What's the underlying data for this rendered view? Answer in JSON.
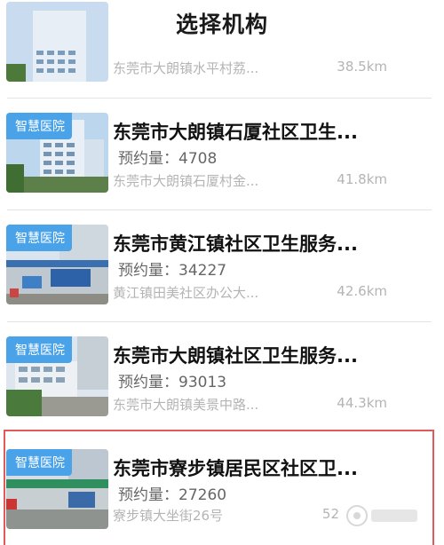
{
  "header": {
    "title": "选择机构"
  },
  "items": [
    {
      "badge": "",
      "name": "",
      "count_label": "",
      "address": "东莞市大朗镇水平村荔...",
      "distance": "38.5km"
    },
    {
      "badge": "智慧医院",
      "name": "东莞市大朗镇石厦社区卫生...",
      "count_label": "预约量：4708",
      "address": "东莞市大朗镇石厦村金...",
      "distance": "41.8km"
    },
    {
      "badge": "智慧医院",
      "name": "东莞市黄江镇社区卫生服务...",
      "count_label": "预约量：34227",
      "address": "黄江镇田美社区办公大...",
      "distance": "42.6km"
    },
    {
      "badge": "智慧医院",
      "name": "东莞市大朗镇社区卫生服务...",
      "count_label": "预约量：93013",
      "address": "东莞市大朗镇美景中路...",
      "distance": "44.3km"
    },
    {
      "badge": "智慧医院",
      "name": "东莞市寮步镇居民区社区卫...",
      "count_label": "预约量：27260",
      "address": "寮步镇大坐街26号",
      "distance": "52"
    }
  ],
  "colors": {
    "badge": "#4aa3e8",
    "selected_border": "#e05a5a"
  }
}
